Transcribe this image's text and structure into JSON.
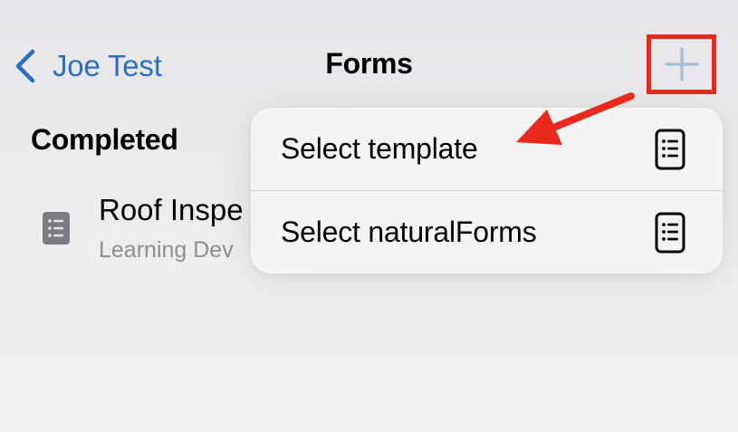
{
  "navbar": {
    "back_label": "Joe Test",
    "title": "Forms"
  },
  "section": {
    "header": "Completed"
  },
  "list": {
    "items": [
      {
        "title": "Roof Inspe",
        "subtitle": "Learning Dev"
      }
    ]
  },
  "menu": {
    "items": [
      {
        "label": "Select template",
        "icon": "form-document-icon"
      },
      {
        "label": "Select naturalForms",
        "icon": "form-document-icon"
      }
    ]
  },
  "annotations": {
    "highlight_color": "#e8291c",
    "arrow_color": "#e8291c"
  },
  "colors": {
    "link_blue": "#2c6fc0",
    "plus_icon": "#a9bed6",
    "secondary_text": "#8e8e93"
  }
}
